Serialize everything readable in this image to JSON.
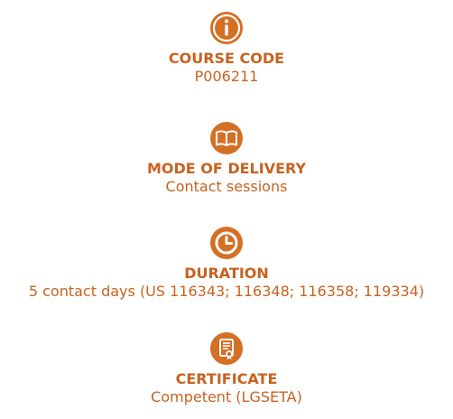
{
  "colors": {
    "accent": "#d46f24",
    "text": "#c8621f"
  },
  "items": [
    {
      "icon": "info-icon",
      "title": "COURSE CODE",
      "value": "P006211"
    },
    {
      "icon": "book-icon",
      "title": "MODE OF DELIVERY",
      "value": "Contact sessions"
    },
    {
      "icon": "clock-icon",
      "title": "DURATION",
      "value": "5 contact days (US 116343; 116348; 116358; 119334)"
    },
    {
      "icon": "certificate-icon",
      "title": "CERTIFICATE",
      "value": "Competent (LGSETA)"
    }
  ]
}
